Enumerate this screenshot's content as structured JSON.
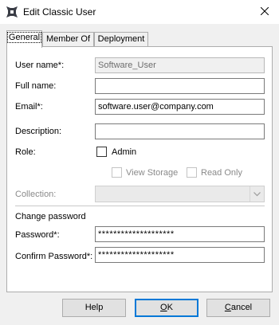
{
  "window": {
    "title": "Edit Classic User",
    "icon": "app-logo-icon",
    "close_icon": "close-icon"
  },
  "tabs": [
    {
      "label": "General",
      "active": true
    },
    {
      "label": "Member Of",
      "active": false
    },
    {
      "label": "Deployment",
      "active": false
    }
  ],
  "form": {
    "user_name": {
      "label": "User name*:",
      "value": "Software_User",
      "readonly": true
    },
    "full_name": {
      "label": "Full name:",
      "value": ""
    },
    "email": {
      "label": "Email*:",
      "value": "software.user@company.com"
    },
    "description": {
      "label": "Description:",
      "value": ""
    },
    "role": {
      "label": "Role:",
      "admin": {
        "label": "Admin",
        "checked": false
      },
      "view_storage": {
        "label": "View Storage",
        "checked": false,
        "disabled": true
      },
      "read_only": {
        "label": "Read Only",
        "checked": false,
        "disabled": true
      }
    },
    "collection": {
      "label": "Collection:",
      "value": "",
      "disabled": true
    },
    "change_password_heading": "Change password",
    "password": {
      "label": "Password*:",
      "value": "********************"
    },
    "confirm_password": {
      "label": "Confirm Password*:",
      "value": "********************"
    }
  },
  "buttons": {
    "help": {
      "label": "Help"
    },
    "ok": {
      "first": "O",
      "rest": "K"
    },
    "cancel": {
      "first": "C",
      "rest": "ancel"
    }
  }
}
